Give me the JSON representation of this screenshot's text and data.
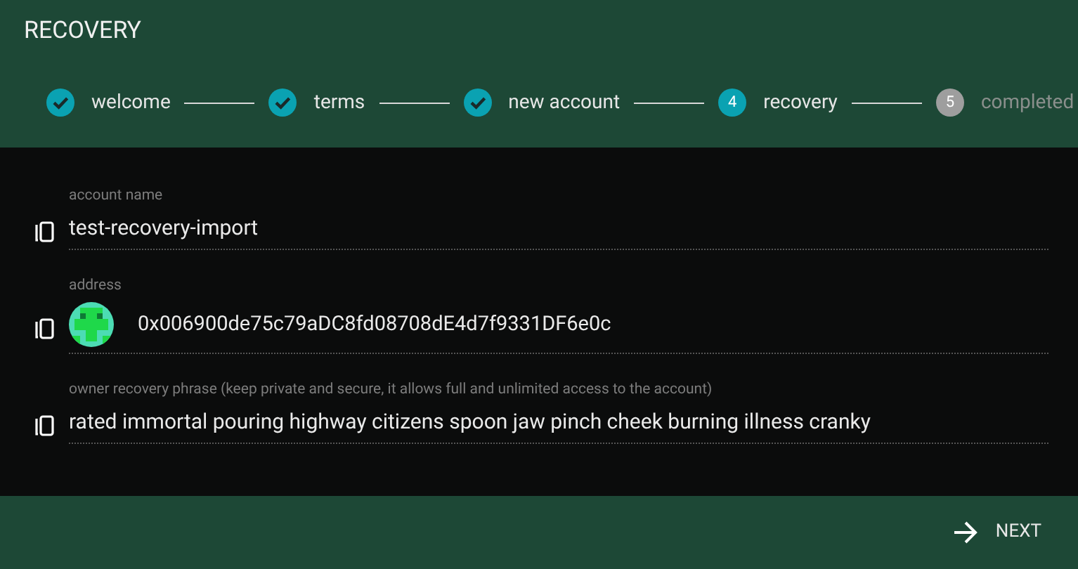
{
  "window": {
    "title": "RECOVERY"
  },
  "steps": [
    {
      "label": "welcome",
      "kind": "done"
    },
    {
      "label": "terms",
      "kind": "done"
    },
    {
      "label": "new account",
      "kind": "done"
    },
    {
      "label": "recovery",
      "kind": "current",
      "number": "4"
    },
    {
      "label": "completed",
      "kind": "pending",
      "number": "5"
    }
  ],
  "fields": [
    {
      "label": "account name",
      "value": "test-recovery-import",
      "kind": "text"
    },
    {
      "label": "address",
      "value": "0x006900de75c79aDC8fd08708dE4d7f9331DF6e0c",
      "kind": "address"
    },
    {
      "label": "owner recovery phrase (keep private and secure, it allows full and unlimited access to the account)",
      "value": "rated immortal pouring highway citizens spoon jaw pinch cheek burning illness cranky",
      "kind": "text"
    }
  ],
  "next_button": {
    "label": "NEXT"
  }
}
